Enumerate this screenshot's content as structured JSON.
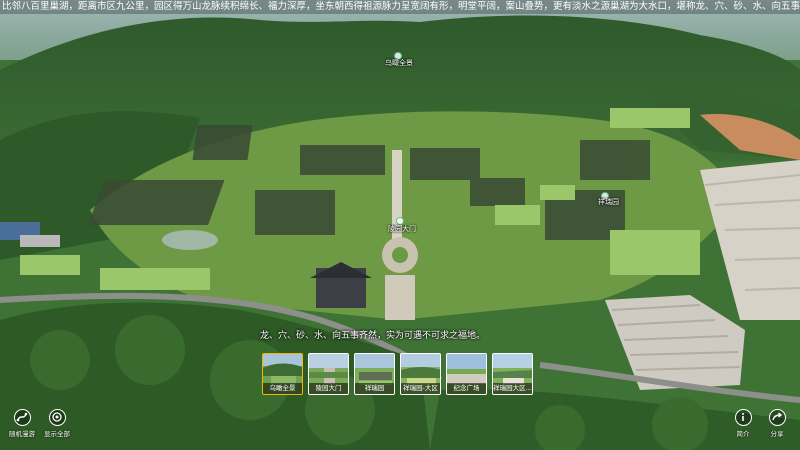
{
  "marquee": {
    "text": "比邻八百里巢湖，距离市区九公里，园区得万山龙脉续积绵长、福力深厚，坐东朝西得祖源脉力呈宽阔有形，明堂平阔，案山叠势，更有淡水之源巢湖为大水口，堪称龙、穴、砂、水、向五事齐然"
  },
  "hotspots": [
    {
      "label": "乌瞰全景"
    },
    {
      "label": "陵园大门"
    },
    {
      "label": "祥瑞园"
    }
  ],
  "caption": {
    "text": "龙、穴、砂、水、向五事齐然，实为可遇不可求之福地。"
  },
  "scenes": [
    {
      "label": "乌瞰全景",
      "active": true
    },
    {
      "label": "陵园大门",
      "active": false
    },
    {
      "label": "祥瑞园",
      "active": false
    },
    {
      "label": "祥瑞园-大区",
      "active": false
    },
    {
      "label": "纪念广场",
      "active": false
    },
    {
      "label": "祥瑞园大区...",
      "active": false
    }
  ],
  "controls": {
    "left1": "随机漫游",
    "left2": "显示全部",
    "right1": "简介",
    "right2": "分享"
  },
  "colors": {
    "active_border": "#f5b400"
  }
}
